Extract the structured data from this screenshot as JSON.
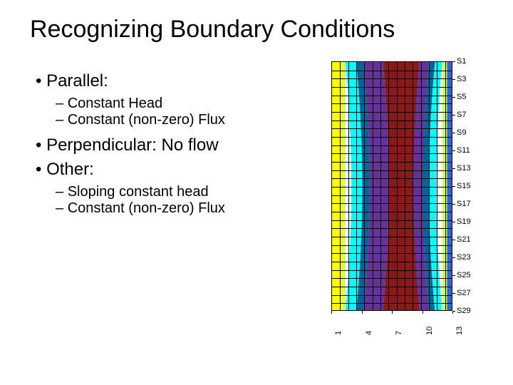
{
  "title": "Recognizing Boundary Conditions",
  "bullets": {
    "b1": "Parallel:",
    "b1s1": "Constant Head",
    "b1s2": "Constant (non-zero) Flux",
    "b2": "Perpendicular: No flow",
    "b3": "Other:",
    "b3s1": "Sloping constant head",
    "b3s2": "Constant (non-zero) Flux"
  },
  "chart_data": {
    "type": "heatmap",
    "title": "",
    "x_ticks": [
      "1",
      "4",
      "7",
      "10",
      "13"
    ],
    "y_ticks": [
      "S1",
      "S3",
      "S5",
      "S7",
      "S9",
      "S11",
      "S13",
      "S15",
      "S17",
      "S19",
      "S21",
      "S23",
      "S25",
      "S27",
      "S29"
    ],
    "grid_cols": 15,
    "grid_rows": 30,
    "bands": [
      {
        "color": "#ffff00",
        "x0": 0.0,
        "w": 0.09
      },
      {
        "color": "#ccff66",
        "x0": 0.09,
        "w": 0.02
      },
      {
        "color": "#00ffff",
        "x0": 0.11,
        "w": 0.09
      },
      {
        "color": "#006699",
        "x0": 0.2,
        "w": 0.06
      },
      {
        "color": "#663399",
        "x0": 0.26,
        "w": 0.16
      },
      {
        "color": "#8b1a1a",
        "x0": 0.42,
        "w": 0.3
      },
      {
        "color": "#663399",
        "x0": 0.72,
        "w": 0.08
      },
      {
        "color": "#006699",
        "x0": 0.8,
        "w": 0.05
      },
      {
        "color": "#00ffff",
        "x0": 0.85,
        "w": 0.06
      },
      {
        "color": "#ccff66",
        "x0": 0.91,
        "w": 0.04
      },
      {
        "color": "#3366cc",
        "x0": 0.95,
        "w": 0.05
      }
    ]
  }
}
